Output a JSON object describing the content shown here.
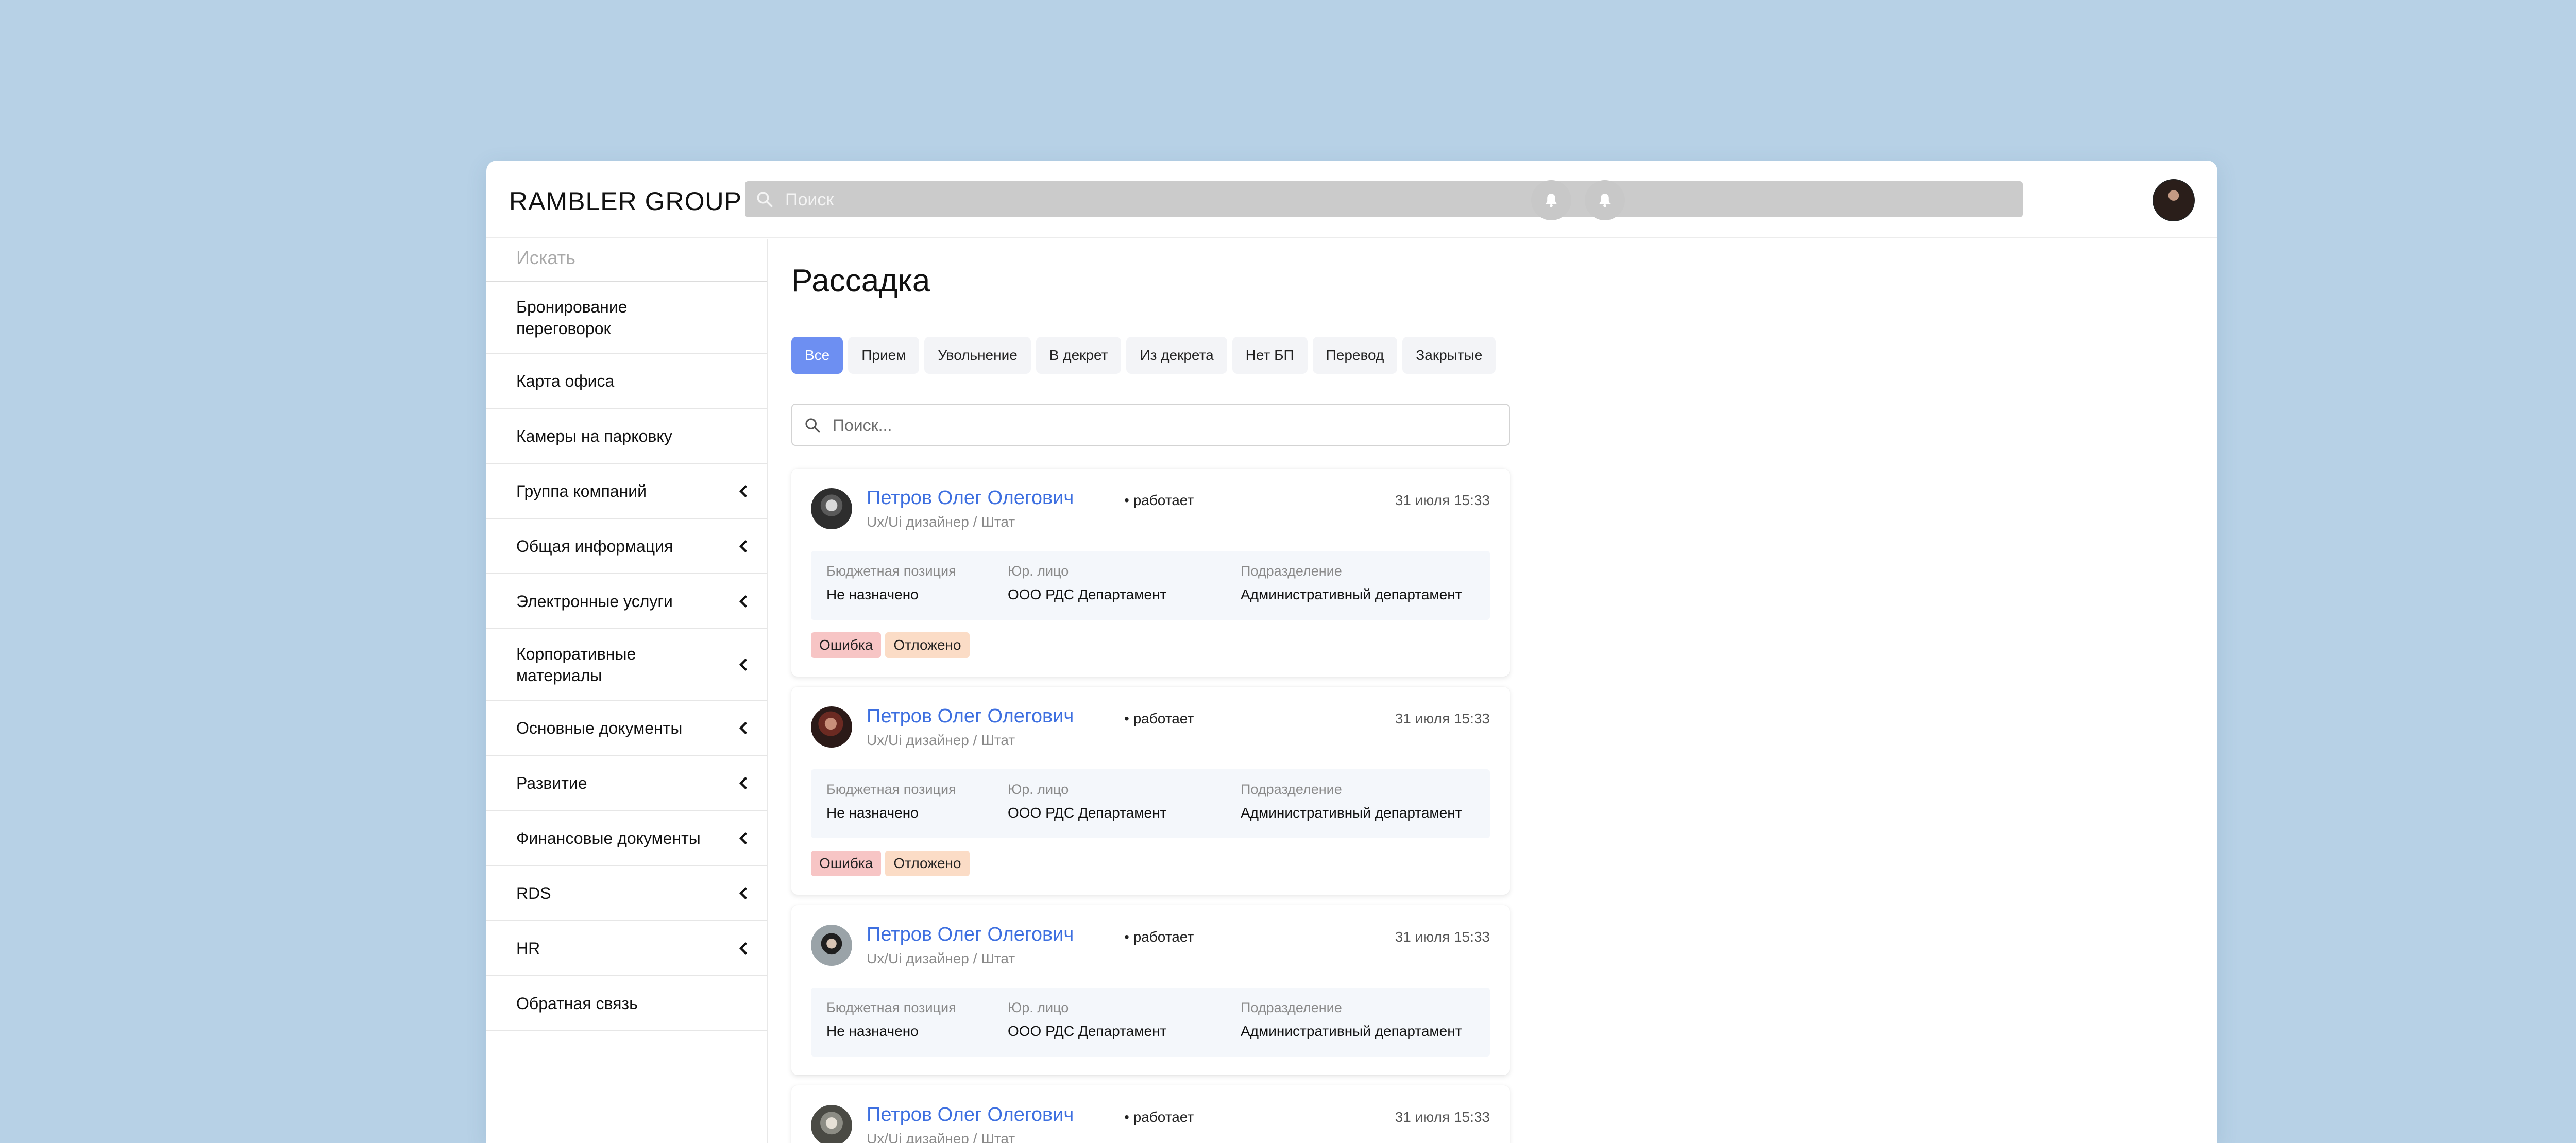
{
  "header": {
    "logo": "RAMBLER GROUP",
    "search_placeholder": "Поиск",
    "icons": [
      "bell-icon",
      "bell-icon"
    ]
  },
  "sidebar": {
    "search_placeholder": "Искать",
    "items": [
      {
        "label": "Бронирование переговорок",
        "has_submenu": false
      },
      {
        "label": "Карта офиса",
        "has_submenu": false
      },
      {
        "label": "Камеры на парковку",
        "has_submenu": false
      },
      {
        "label": "Группа компаний",
        "has_submenu": true
      },
      {
        "label": "Общая информация",
        "has_submenu": true
      },
      {
        "label": "Электронные услуги",
        "has_submenu": true
      },
      {
        "label": "Корпоративные материалы",
        "has_submenu": true
      },
      {
        "label": "Основные документы",
        "has_submenu": true
      },
      {
        "label": "Развитие",
        "has_submenu": true
      },
      {
        "label": "Финансовые документы",
        "has_submenu": true
      },
      {
        "label": "RDS",
        "has_submenu": true
      },
      {
        "label": "HR",
        "has_submenu": true
      },
      {
        "label": "Обратная связь",
        "has_submenu": false
      }
    ]
  },
  "main": {
    "title": "Рассадка",
    "tabs": [
      {
        "label": "Все",
        "active": true
      },
      {
        "label": "Прием",
        "active": false
      },
      {
        "label": "Увольнение",
        "active": false
      },
      {
        "label": "В декрет",
        "active": false
      },
      {
        "label": "Из декрета",
        "active": false
      },
      {
        "label": "Нет БП",
        "active": false
      },
      {
        "label": "Перевод",
        "active": false
      },
      {
        "label": "Закрытые",
        "active": false
      }
    ],
    "search_placeholder": "Поиск...",
    "cards": [
      {
        "name": "Петров Олег Олегович",
        "status": "• работает",
        "role": "Ux/Ui дизайнер / Штат",
        "date": "31 июля 15:33",
        "budget_label": "Бюджетная позиция",
        "budget_value": "Не назначено",
        "entity_label": "Юр. лицо",
        "entity_value": "ООО РДС Департамент",
        "dept_label": "Подразделение",
        "dept_value": "Административный департамент",
        "badges": [
          "Ошибка",
          "Отложено"
        ]
      },
      {
        "name": "Петров Олег Олегович",
        "status": "• работает",
        "role": "Ux/Ui дизайнер / Штат",
        "date": "31 июля 15:33",
        "budget_label": "Бюджетная позиция",
        "budget_value": "Не назначено",
        "entity_label": "Юр. лицо",
        "entity_value": "ООО РДС Департамент",
        "dept_label": "Подразделение",
        "dept_value": "Административный департамент",
        "badges": [
          "Ошибка",
          "Отложено"
        ]
      },
      {
        "name": "Петров Олег Олегович",
        "status": "• работает",
        "role": "Ux/Ui дизайнер / Штат",
        "date": "31 июля 15:33",
        "budget_label": "Бюджетная позиция",
        "budget_value": "Не назначено",
        "entity_label": "Юр. лицо",
        "entity_value": "ООО РДС Департамент",
        "dept_label": "Подразделение",
        "dept_value": "Административный департамент",
        "badges": []
      },
      {
        "name": "Петров Олег Олегович",
        "status": "• работает",
        "role": "Ux/Ui дизайнер / Штат",
        "date": "31 июля 15:33"
      }
    ]
  },
  "colors": {
    "background": "#b7d1e6",
    "accent": "#6d8ff2",
    "link": "#3d6fe0",
    "error_badge": "#f7c5c5",
    "deferred_badge": "#fbdcc6"
  }
}
